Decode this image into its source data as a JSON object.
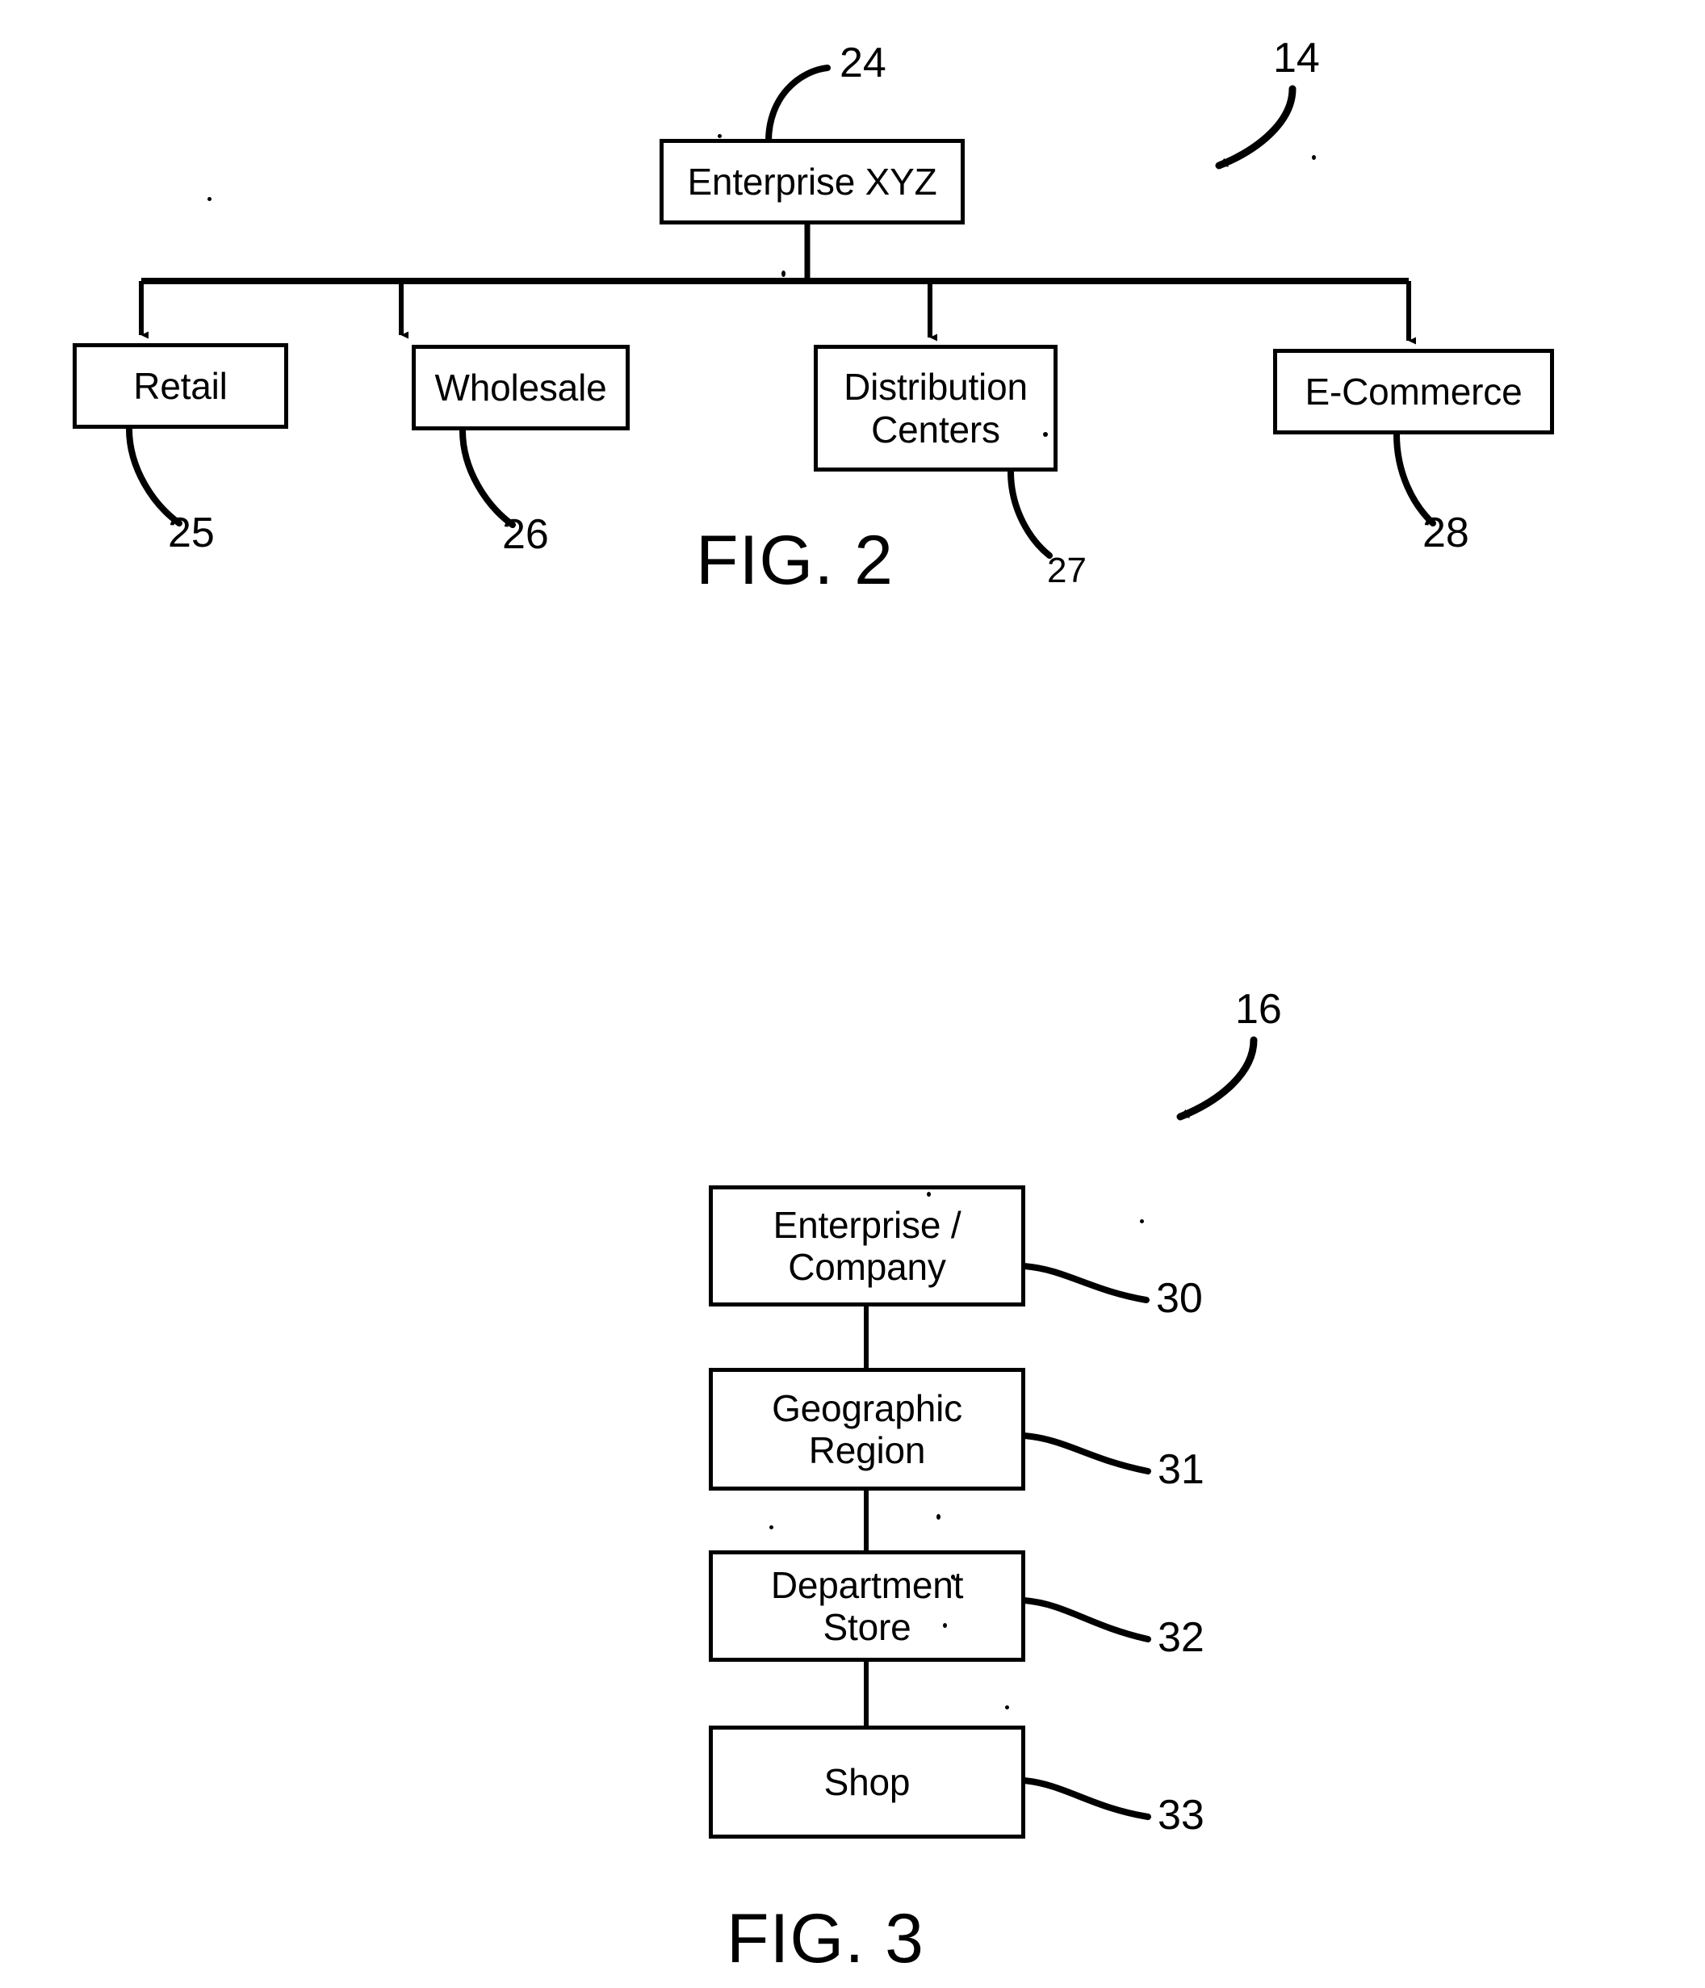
{
  "document": {
    "type": "patent-figure-sheet",
    "background_color": "#ffffff",
    "ink_color": "#000000"
  },
  "figures": [
    {
      "id": "fig2",
      "caption": "FIG. 2",
      "overall_ref": "14",
      "root": {
        "label": "Enterprise XYZ",
        "ref": "24"
      },
      "children": [
        {
          "label": "Retail",
          "ref": "25"
        },
        {
          "label": "Wholesale",
          "ref": "26"
        },
        {
          "label": "Distribution\nCenters",
          "ref": "27"
        },
        {
          "label": "E-Commerce",
          "ref": "28"
        }
      ]
    },
    {
      "id": "fig3",
      "caption": "FIG. 3",
      "overall_ref": "16",
      "levels": [
        {
          "label": "Enterprise /\nCompany",
          "ref": "30"
        },
        {
          "label": "Geographic\nRegion",
          "ref": "31"
        },
        {
          "label": "Department\nStore",
          "ref": "32"
        },
        {
          "label": "Shop",
          "ref": "33"
        }
      ]
    }
  ],
  "chart_data": {
    "type": "diagram",
    "title": "Enterprise hierarchy figures",
    "diagrams": [
      {
        "name": "FIG. 2",
        "kind": "tree",
        "orientation": "top-down",
        "reference_numeral": "14",
        "nodes": [
          {
            "id": "24",
            "label": "Enterprise XYZ",
            "level": 0
          },
          {
            "id": "25",
            "label": "Retail",
            "level": 1
          },
          {
            "id": "26",
            "label": "Wholesale",
            "level": 1
          },
          {
            "id": "27",
            "label": "Distribution Centers",
            "level": 1
          },
          {
            "id": "28",
            "label": "E-Commerce",
            "level": 1
          }
        ],
        "edges": [
          {
            "from": "24",
            "to": "25",
            "arrow": true
          },
          {
            "from": "24",
            "to": "26",
            "arrow": true
          },
          {
            "from": "24",
            "to": "27",
            "arrow": true
          },
          {
            "from": "24",
            "to": "28",
            "arrow": true
          }
        ]
      },
      {
        "name": "FIG. 3",
        "kind": "chain",
        "orientation": "vertical",
        "reference_numeral": "16",
        "nodes": [
          {
            "id": "30",
            "label": "Enterprise / Company",
            "level": 0
          },
          {
            "id": "31",
            "label": "Geographic Region",
            "level": 1
          },
          {
            "id": "32",
            "label": "Department Store",
            "level": 2
          },
          {
            "id": "33",
            "label": "Shop",
            "level": 3
          }
        ],
        "edges": [
          {
            "from": "30",
            "to": "31",
            "arrow": false
          },
          {
            "from": "31",
            "to": "32",
            "arrow": false
          },
          {
            "from": "32",
            "to": "33",
            "arrow": false
          }
        ]
      }
    ]
  }
}
